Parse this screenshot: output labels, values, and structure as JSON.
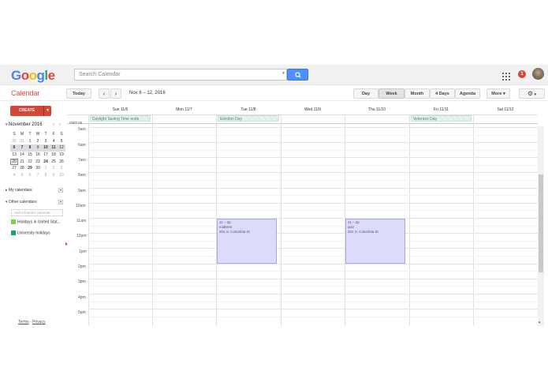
{
  "app": {
    "logo": "Google",
    "title": "Calendar"
  },
  "search": {
    "placeholder": "Search Calendar"
  },
  "notifications": {
    "count": "1"
  },
  "toolbar": {
    "today_label": "Today",
    "date_range": "Nov 6 – 12, 2016",
    "views": [
      "Day",
      "Week",
      "Month",
      "4 Days",
      "Agenda"
    ],
    "active_view": "Week",
    "more_label": "More ▾"
  },
  "sidebar": {
    "create_label": "CREATE",
    "mini_calendar": {
      "month": "November 2016",
      "weekdays": [
        "S",
        "M",
        "T",
        "W",
        "T",
        "F",
        "S"
      ],
      "rows": [
        [
          "30",
          "31",
          "1",
          "2",
          "3",
          "4",
          "5"
        ],
        [
          "6",
          "7",
          "8",
          "9",
          "10",
          "11",
          "12"
        ],
        [
          "13",
          "14",
          "15",
          "16",
          "17",
          "18",
          "19"
        ],
        [
          "20",
          "21",
          "22",
          "23",
          "24",
          "25",
          "26"
        ],
        [
          "27",
          "28",
          "29",
          "30",
          "1",
          "2",
          "3"
        ],
        [
          "4",
          "5",
          "6",
          "7",
          "8",
          "9",
          "10"
        ]
      ]
    },
    "my_calendars_label": "My calendars",
    "other_calendars_label": "Other calendars",
    "add_friend_placeholder": "Add a friend's calendar",
    "other_calendars": [
      {
        "name": "Holidays in United Stat...",
        "color": "#7bd148"
      },
      {
        "name": "University holidays",
        "color": "#16a765"
      }
    ],
    "footer": {
      "terms": "Terms",
      "sep": " - ",
      "privacy": "Privacy"
    }
  },
  "week": {
    "timezone": "GMT-05",
    "days": [
      "Sun 11/6",
      "Mon 11/7",
      "Tue 11/8",
      "Wed 11/9",
      "Thu 11/10",
      "Fri 11/11",
      "Sat 11/12"
    ],
    "all_day_events": [
      {
        "day": 0,
        "title": "Daylight Saving Time ends"
      },
      {
        "day": 2,
        "title": "Election Day"
      },
      {
        "day": 5,
        "title": "Veterans Day"
      }
    ],
    "hours": [
      "5am",
      "6am",
      "7am",
      "8am",
      "9am",
      "10am",
      "11am",
      "12pm",
      "1pm",
      "2pm",
      "3pm",
      "4pm",
      "5pm"
    ],
    "events": [
      {
        "day": 2,
        "time": "11 – 2p",
        "title": "midterm",
        "location": "201 S. Columbia St"
      },
      {
        "day": 4,
        "time": "11 – 2p",
        "title": "quiz",
        "location": "201 S. Columbia St"
      }
    ]
  }
}
